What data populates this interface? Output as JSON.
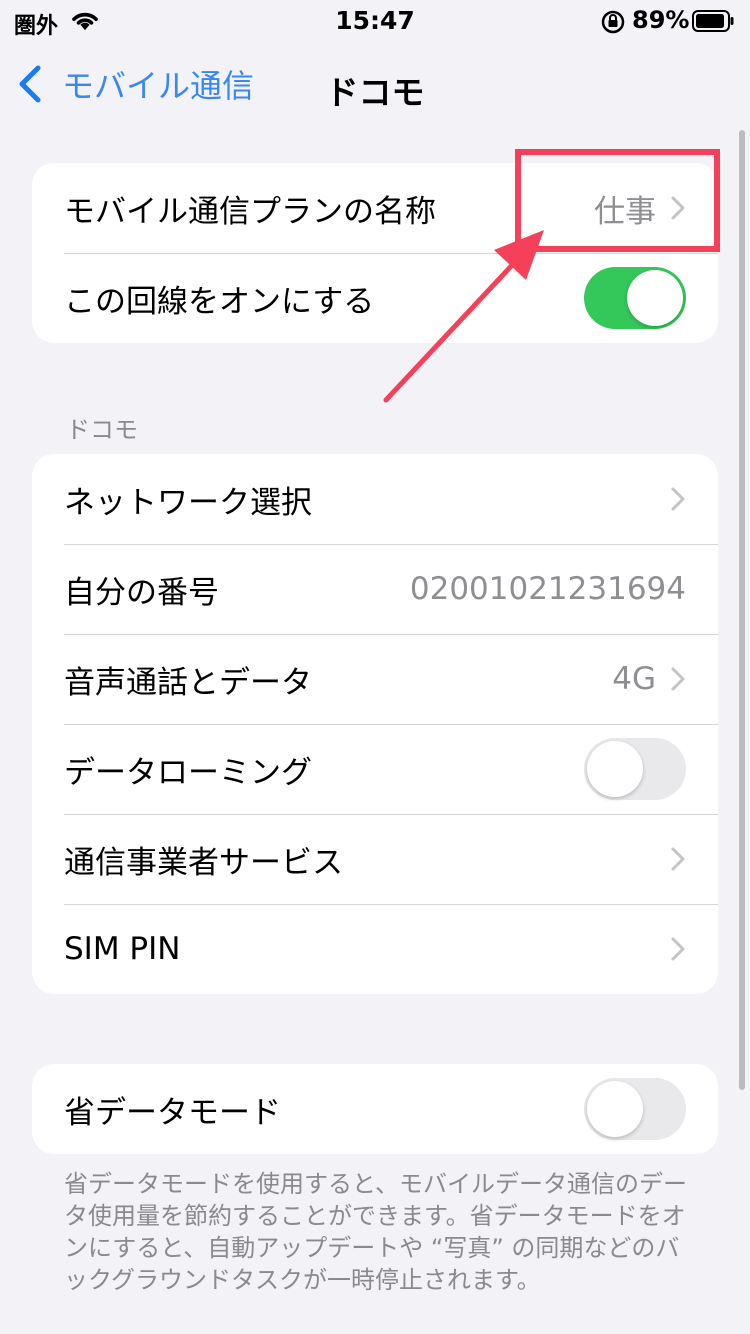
{
  "status_bar": {
    "carrier": "圏外",
    "time": "15:47",
    "battery": "89%"
  },
  "nav": {
    "back_label": "モバイル通信",
    "title": "ドコモ"
  },
  "group1": {
    "plan_label": "モバイル通信プランの名称",
    "plan_value": "仕事",
    "line_label": "この回線をオンにする",
    "line_on": true
  },
  "section_header": "ドコモ",
  "group2": {
    "network_label": "ネットワーク選択",
    "number_label": "自分の番号",
    "number_value": "02001021231694",
    "voice_label": "音声通話とデータ",
    "voice_value": "4G",
    "roaming_label": "データローミング",
    "roaming_on": false,
    "carrier_services_label": "通信事業者サービス",
    "sim_pin_label": "SIM PIN"
  },
  "group3": {
    "low_data_label": "省データモード",
    "low_data_on": false
  },
  "footer": "省データモードを使用すると、モバイルデータ通信のデータ使用量を節約することができます。省データモードをオンにすると、自動アップデートや “写真” の同期などのバックグラウンドタスクが一時停止されます。",
  "colors": {
    "accent": "#1a7cf5",
    "toggle_on": "#34c759",
    "annotation": "#f5405a"
  }
}
